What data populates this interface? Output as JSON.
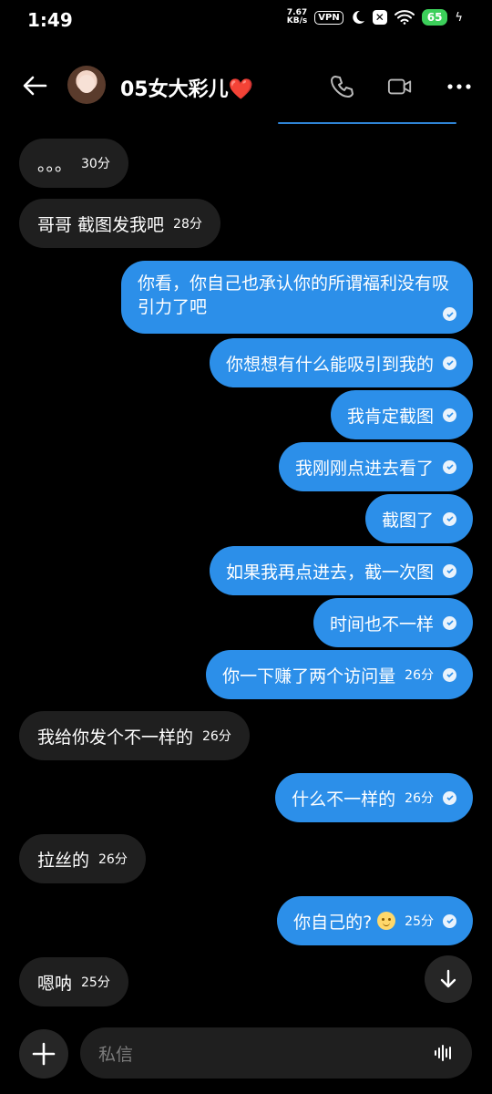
{
  "status": {
    "time": "1:49",
    "speed_value": "7.67",
    "speed_unit": "KB/s",
    "vpn": "VPN",
    "battery": "65",
    "icons": [
      "moon-icon",
      "x-badge-icon",
      "wifi-icon",
      "battery-icon",
      "charging-icon"
    ]
  },
  "header": {
    "contact_name": "05女大彩儿",
    "heart": "❤️",
    "icons": [
      "back-arrow-icon",
      "phone-icon",
      "video-icon",
      "more-icon"
    ]
  },
  "messages": [
    {
      "dir": "in",
      "text": "。。。",
      "time": "30分"
    },
    {
      "dir": "in",
      "text": "哥哥 截图发我吧",
      "time": "28分"
    },
    {
      "dir": "out",
      "text": "你看，你自己也承认你的所谓福利没有吸引力了吧",
      "time": ""
    },
    {
      "dir": "out",
      "text": "你想想有什么能吸引到我的",
      "time": ""
    },
    {
      "dir": "out",
      "text": "我肯定截图",
      "time": ""
    },
    {
      "dir": "out",
      "text": "我刚刚点进去看了",
      "time": ""
    },
    {
      "dir": "out",
      "text": "截图了",
      "time": ""
    },
    {
      "dir": "out",
      "text": "如果我再点进去，截一次图",
      "time": ""
    },
    {
      "dir": "out",
      "text": "时间也不一样",
      "time": ""
    },
    {
      "dir": "out",
      "text": "你一下赚了两个访问量",
      "time": "26分"
    },
    {
      "dir": "in",
      "text": "我给你发个不一样的",
      "time": "26分"
    },
    {
      "dir": "out",
      "text": "什么不一样的",
      "time": "26分"
    },
    {
      "dir": "in",
      "text": "拉丝的",
      "time": "26分"
    },
    {
      "dir": "out",
      "text": "你自己的?",
      "time": "25分",
      "emoji": "smile-emoji"
    },
    {
      "dir": "in",
      "text": "嗯呐",
      "time": "25分"
    }
  ],
  "composer": {
    "placeholder": "私信",
    "icons": [
      "plus-icon",
      "voice-icon",
      "scroll-down-icon"
    ]
  }
}
